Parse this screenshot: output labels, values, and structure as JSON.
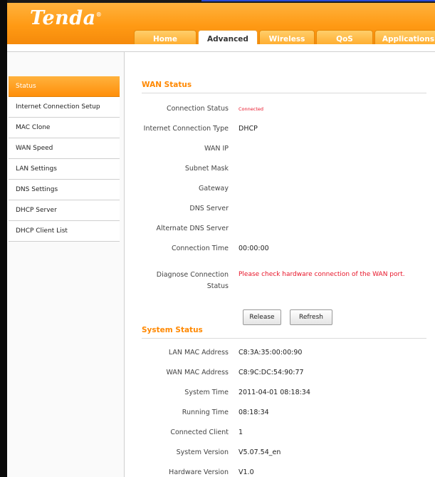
{
  "brand": {
    "logo_text": "Tenda",
    "logo_mark": "®"
  },
  "nav": {
    "tabs": [
      {
        "label": "Home"
      },
      {
        "label": "Advanced"
      },
      {
        "label": "Wireless"
      },
      {
        "label": "QoS"
      },
      {
        "label": "Applications"
      }
    ],
    "active_tab": "Advanced"
  },
  "sidebar": {
    "items": [
      {
        "label": "Status"
      },
      {
        "label": "Internet Connection Setup"
      },
      {
        "label": "MAC Clone"
      },
      {
        "label": "WAN Speed"
      },
      {
        "label": "LAN Settings"
      },
      {
        "label": "DNS Settings"
      },
      {
        "label": "DHCP Server"
      },
      {
        "label": "DHCP Client List"
      }
    ],
    "active_item": "Status"
  },
  "wan_status": {
    "title": "WAN Status",
    "rows": [
      {
        "label": "Connection Status",
        "value": "Connected"
      },
      {
        "label": "Internet Connection Type",
        "value": "DHCP"
      },
      {
        "label": "WAN IP",
        "value": ""
      },
      {
        "label": "Subnet Mask",
        "value": ""
      },
      {
        "label": "Gateway",
        "value": ""
      },
      {
        "label": "DNS Server",
        "value": ""
      },
      {
        "label": "Alternate DNS Server",
        "value": ""
      },
      {
        "label": "Connection Time",
        "value": "00:00:00"
      }
    ],
    "diagnose": {
      "label_line1": "Diagnose Connection",
      "label_line2": "Status",
      "value": "Please check hardware connection of the WAN port."
    },
    "buttons": {
      "release": "Release",
      "refresh": "Refresh"
    }
  },
  "system_status": {
    "title": "System Status",
    "rows": [
      {
        "label": "LAN MAC Address",
        "value": "C8:3A:35:00:00:90"
      },
      {
        "label": "WAN MAC Address",
        "value": "C8:9C:DC:54:90:77"
      },
      {
        "label": "System Time",
        "value": "2011-04-01 08:18:34"
      },
      {
        "label": "Running Time",
        "value": "08:18:34"
      },
      {
        "label": "Connected Client",
        "value": "1"
      },
      {
        "label": "System Version",
        "value": "V5.07.54_en"
      },
      {
        "label": "Hardware Version",
        "value": "V1.0"
      }
    ]
  },
  "colors": {
    "accent": "#ff9a14",
    "title": "#ff8800",
    "alert": "#e8162a"
  }
}
